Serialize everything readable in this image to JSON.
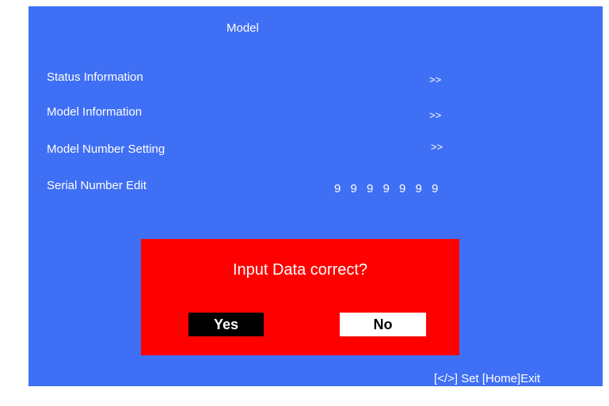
{
  "screen": {
    "title": "Model"
  },
  "menu": [
    {
      "label": "Status Information",
      "value": ">>"
    },
    {
      "label": "Model Information",
      "value": ">>"
    },
    {
      "label": "Model Number Setting",
      "value": ">>"
    },
    {
      "label": "Serial Number Edit",
      "digits": [
        "9",
        "9",
        "9",
        "9",
        "9",
        "9",
        "9"
      ]
    }
  ],
  "dialog": {
    "question": "Input Data correct?",
    "yes_label": "Yes",
    "no_label": "No",
    "selected": "No"
  },
  "footer": {
    "hint": "[</>] Set [Home]Exit"
  },
  "colors": {
    "background": "#3f6ff4",
    "dialog": "#ff0000"
  }
}
